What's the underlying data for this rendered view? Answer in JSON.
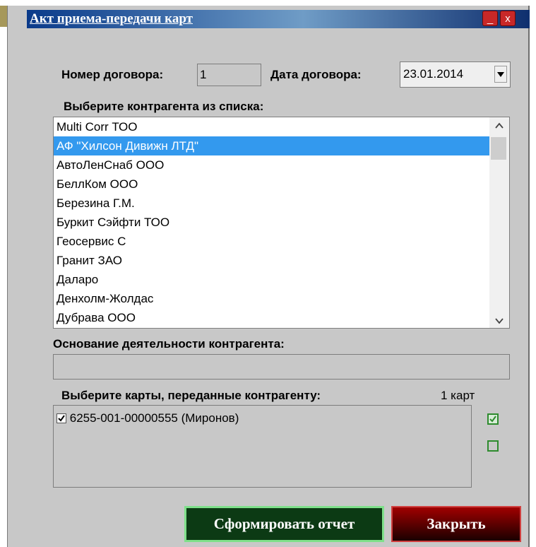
{
  "window": {
    "title": "Акт приема-передачи карт",
    "minimize_label": "_",
    "close_label": "x"
  },
  "contract": {
    "number_label": "Номер договора:",
    "number_value": "1",
    "date_label": "Дата договора:",
    "date_value": "23.01.2014"
  },
  "counterparty": {
    "list_label": "Выберите контрагента из списка:",
    "items": [
      "Multi Corr ТОО",
      "АФ \"Хилсон Дивижн ЛТД\"",
      "АвтоЛенСнаб ООО",
      "БеллКом ООО",
      "Березина Г.М.",
      "Буркит Сэйфти ТОО",
      "Геосервис С",
      "Гранит ЗАО",
      "Даларо",
      "Денхолм-Жолдас",
      "Дубрава ООО"
    ],
    "selected_index": 1,
    "basis_label": "Основание деятельности контрагента:",
    "basis_value": ""
  },
  "cards": {
    "label": "Выберите карты, переданные контрагенту:",
    "count_text": "1 карт",
    "items": [
      {
        "text": "6255-001-00000555 (Миронов)",
        "checked": true
      }
    ]
  },
  "buttons": {
    "report_label": "Сформировать отчет",
    "close_label": "Закрыть"
  },
  "colors": {
    "selection": "#3399ee",
    "check_green": "#2e8b2e",
    "report_button": "#0c3a14",
    "close_button": "#6e0000"
  }
}
